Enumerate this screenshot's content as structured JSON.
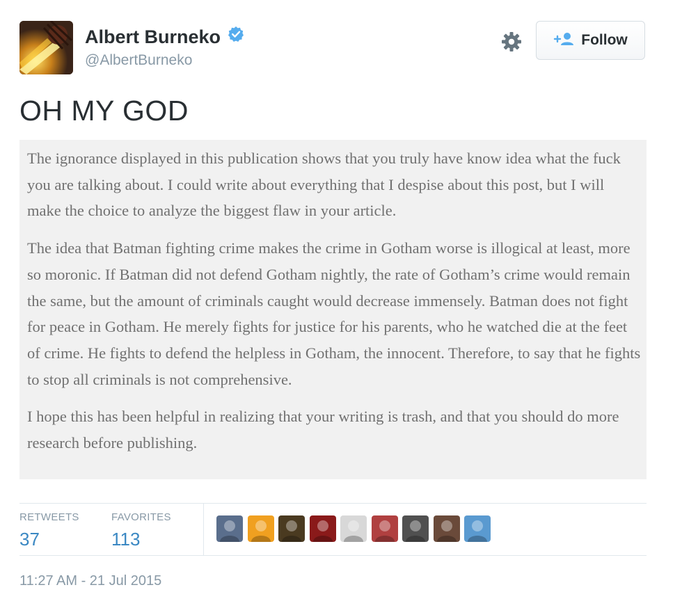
{
  "author": {
    "display_name": "Albert Burneko",
    "handle": "@AlbertBurneko",
    "verified": true,
    "avatar_icon": "user-avatar"
  },
  "actions": {
    "settings_icon": "gear-icon",
    "follow_label": "Follow",
    "follow_icon": "add-user-icon"
  },
  "tweet": {
    "text": "OH MY GOD",
    "image_paragraphs": [
      "The ignorance displayed in this publication shows that you truly have know idea what the fuck you are talking about. I could write about everything that I despise about this post, but I will make the choice to analyze the biggest flaw in your article.",
      "The idea that Batman fighting crime makes the crime in Gotham worse is illogical at least, more so moronic. If Batman did not defend Gotham nightly, the rate of Gotham’s crime would remain the same, but the amount of criminals caught would decrease immensely. Batman does not fight for peace in Gotham. He merely fights for justice for his parents, who he watched die at the feet of crime. He fights to defend the helpless in Gotham, the innocent. Therefore, to say that he fights to stop all criminals is not comprehensive.",
      "I hope this has been helpful in realizing that your writing is trash, and that you should do more research before publishing."
    ]
  },
  "stats": {
    "retweets_label": "RETWEETS",
    "retweets_count": "37",
    "favorites_label": "FAVORITES",
    "favorites_count": "113"
  },
  "favoriters": [
    {
      "icon": "favoriter-avatar",
      "color": "#5a6e8c"
    },
    {
      "icon": "favoriter-avatar",
      "color": "#f0a020"
    },
    {
      "icon": "favoriter-avatar",
      "color": "#4a3a20"
    },
    {
      "icon": "favoriter-avatar",
      "color": "#8a1a1a"
    },
    {
      "icon": "favoriter-avatar",
      "color": "#d8d8d8"
    },
    {
      "icon": "favoriter-avatar",
      "color": "#b04040"
    },
    {
      "icon": "favoriter-avatar",
      "color": "#505050"
    },
    {
      "icon": "favoriter-avatar",
      "color": "#6a4a3a"
    },
    {
      "icon": "favoriter-avatar",
      "color": "#5a9ad0"
    }
  ],
  "timestamp": "11:27 AM - 21 Jul 2015",
  "colors": {
    "link_blue": "#3b88c3",
    "muted_gray": "#8899a6",
    "verified_blue": "#55acee",
    "image_background": "#f1f1f1",
    "image_text": "#707070"
  }
}
